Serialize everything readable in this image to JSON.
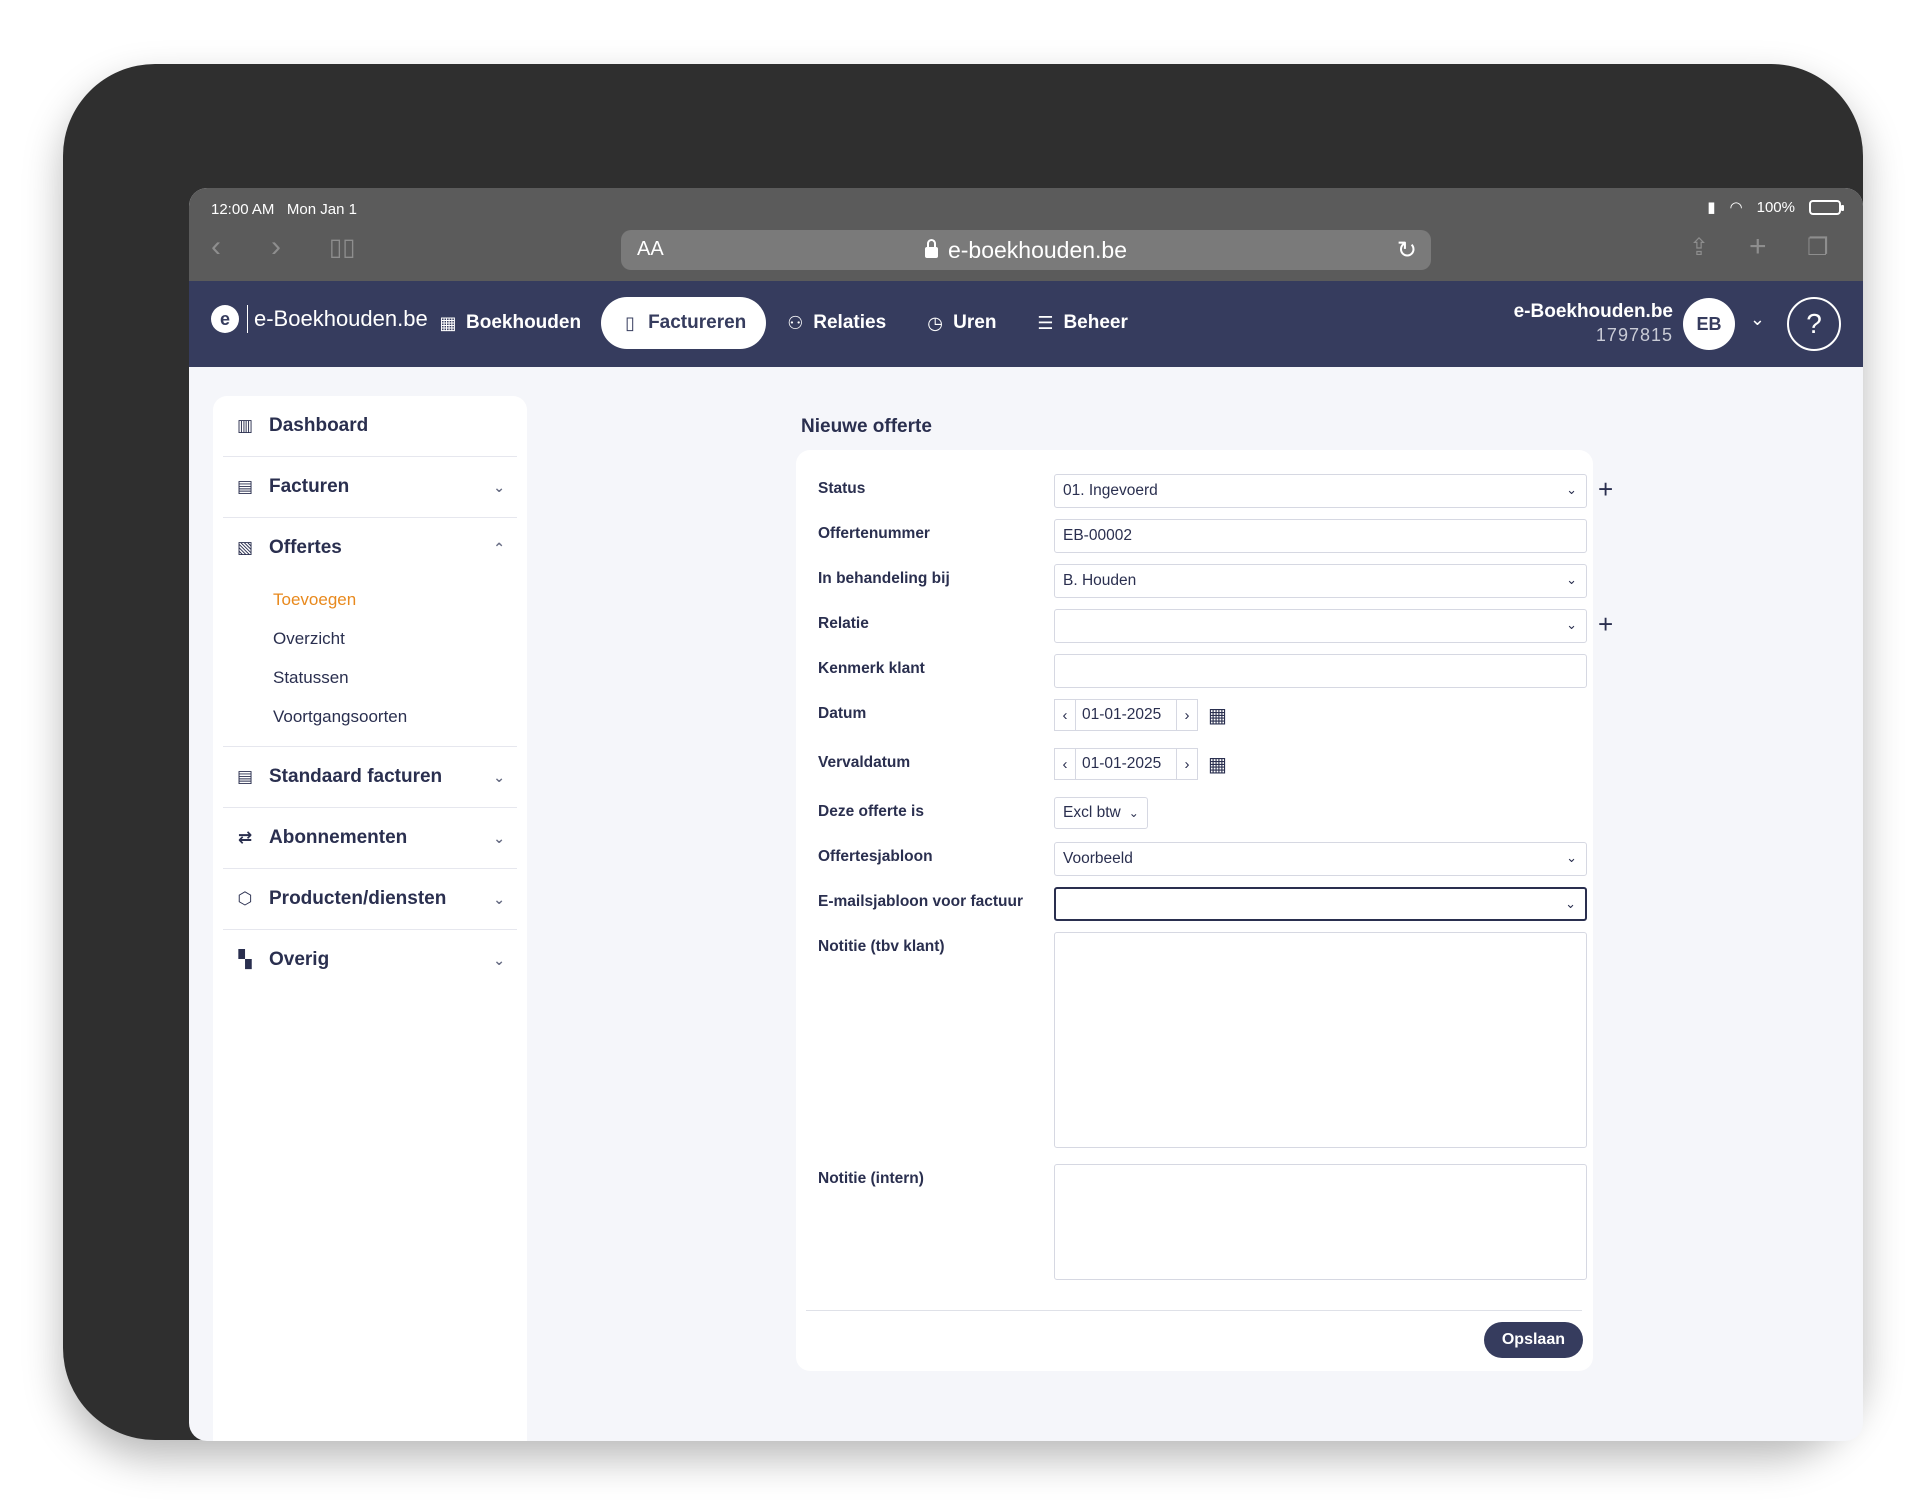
{
  "device": {
    "time": "12:00 AM",
    "date": "Mon Jan 1",
    "battery": "100%"
  },
  "browser": {
    "text_size": "AA",
    "url": "e-boekhouden.be"
  },
  "app": {
    "logo_text": "e-Boekhouden.be",
    "nav": [
      {
        "label": "Boekhouden",
        "icon": "calculator-icon"
      },
      {
        "label": "Factureren",
        "icon": "clipboard-icon",
        "active": true
      },
      {
        "label": "Relaties",
        "icon": "users-icon"
      },
      {
        "label": "Uren",
        "icon": "clock-icon"
      },
      {
        "label": "Beheer",
        "icon": "sliders-icon"
      }
    ],
    "account_name": "e-Boekhouden.be",
    "account_id": "1797815",
    "avatar_initials": "EB",
    "help_label": "?"
  },
  "sidebar": {
    "dashboard": "Dashboard",
    "facturen": "Facturen",
    "offertes": "Offertes",
    "offertes_sub": [
      "Toevoegen",
      "Overzicht",
      "Statussen",
      "Voortgangsoorten"
    ],
    "standaard_facturen": "Standaard facturen",
    "abonnementen": "Abonnementen",
    "producten": "Producten/diensten",
    "overig": "Overig"
  },
  "form": {
    "title": "Nieuwe offerte",
    "fields": {
      "status": {
        "label": "Status",
        "value": "01. Ingevoerd"
      },
      "offertenummer": {
        "label": "Offertenummer",
        "value": "EB-00002"
      },
      "behandeling": {
        "label": "In behandeling bij",
        "value": "B. Houden"
      },
      "relatie": {
        "label": "Relatie",
        "value": ""
      },
      "kenmerk": {
        "label": "Kenmerk klant",
        "value": ""
      },
      "datum": {
        "label": "Datum",
        "value": "01-01-2025"
      },
      "vervaldatum": {
        "label": "Vervaldatum",
        "value": "01-01-2025"
      },
      "offerte_is": {
        "label": "Deze offerte is",
        "value": "Excl btw"
      },
      "sjabloon": {
        "label": "Offertesjabloon",
        "value": "Voorbeeld"
      },
      "emailsjabloon": {
        "label": "E-mailsjabloon voor factuur",
        "value": ""
      },
      "notitie_klant": {
        "label": "Notitie (tbv klant)",
        "value": ""
      },
      "notitie_intern": {
        "label": "Notitie (intern)",
        "value": ""
      }
    },
    "save_label": "Opslaan"
  },
  "colors": {
    "header": "#363c5e",
    "accent_orange": "#e8891d",
    "background": "#f5f6fa"
  }
}
